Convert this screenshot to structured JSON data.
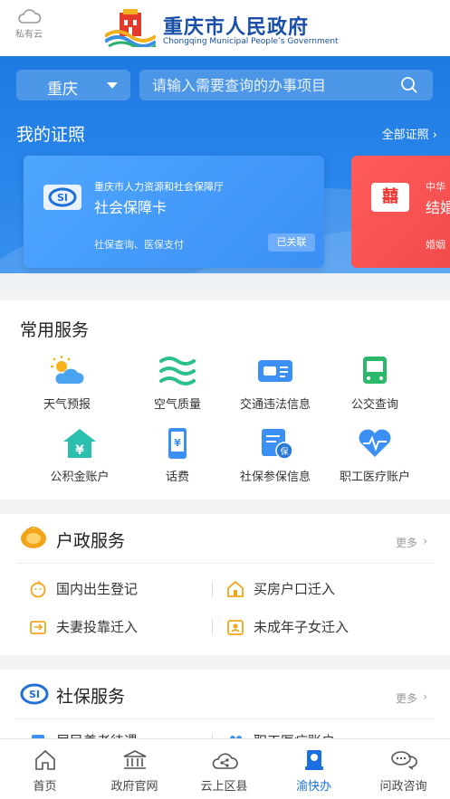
{
  "header": {
    "cloud_label": "私有云",
    "title": "重庆市人民政府",
    "subtitle": "Chongqing Municipal People’s Government"
  },
  "search": {
    "city": "重庆",
    "placeholder": "请输入需要查询的办事项目"
  },
  "certificates": {
    "title": "我的证照",
    "all_label": "全部证照",
    "cards": [
      {
        "org": "重庆市人力资源和社会保障厅",
        "name": "社会保障卡",
        "desc": "社保查询、医保支付",
        "tag": "已关联",
        "color": "#3b8ff5"
      },
      {
        "org": "中华",
        "name": "结婚",
        "desc": "婚姻",
        "icon_text": "囍",
        "color": "#f24848"
      }
    ]
  },
  "common_services": {
    "title": "常用服务",
    "items": [
      {
        "label": "天气预报",
        "icon": "weather-icon"
      },
      {
        "label": "空气质量",
        "icon": "air-quality-icon"
      },
      {
        "label": "交通违法信息",
        "icon": "traffic-violation-icon"
      },
      {
        "label": "公交查询",
        "icon": "bus-icon"
      },
      {
        "label": "公积金账户",
        "icon": "housing-fund-icon"
      },
      {
        "label": "话费",
        "icon": "phone-bill-icon"
      },
      {
        "label": "社保参保信息",
        "icon": "social-insurance-icon"
      },
      {
        "label": "职工医疗账户",
        "icon": "medical-account-icon"
      }
    ]
  },
  "hukou": {
    "title": "户政服务",
    "more": "更多",
    "items": [
      {
        "label": "国内出生登记",
        "icon": "baby-icon"
      },
      {
        "label": "买房户口迁入",
        "icon": "house-icon"
      },
      {
        "label": "夫妻投靠迁入",
        "icon": "transfer-icon"
      },
      {
        "label": "未成年子女迁入",
        "icon": "child-icon"
      }
    ]
  },
  "shebao": {
    "title": "社保服务",
    "more": "更多",
    "items": [
      {
        "label": "居民养老待遇"
      },
      {
        "label": "职工医疗账户"
      }
    ]
  },
  "bottom_nav": [
    {
      "label": "首页",
      "icon": "home-icon"
    },
    {
      "label": "政府官网",
      "icon": "government-icon"
    },
    {
      "label": "云上区县",
      "icon": "cloud-share-icon"
    },
    {
      "label": "渝快办",
      "icon": "yukuaiban-icon",
      "active": true
    },
    {
      "label": "问政咨询",
      "icon": "consult-icon"
    }
  ],
  "colors": {
    "brand": "#1a4fa8",
    "hero_blue": "#2a86ea",
    "active_nav": "#1a6fe0",
    "hukou_icon": "#f2a51a"
  }
}
